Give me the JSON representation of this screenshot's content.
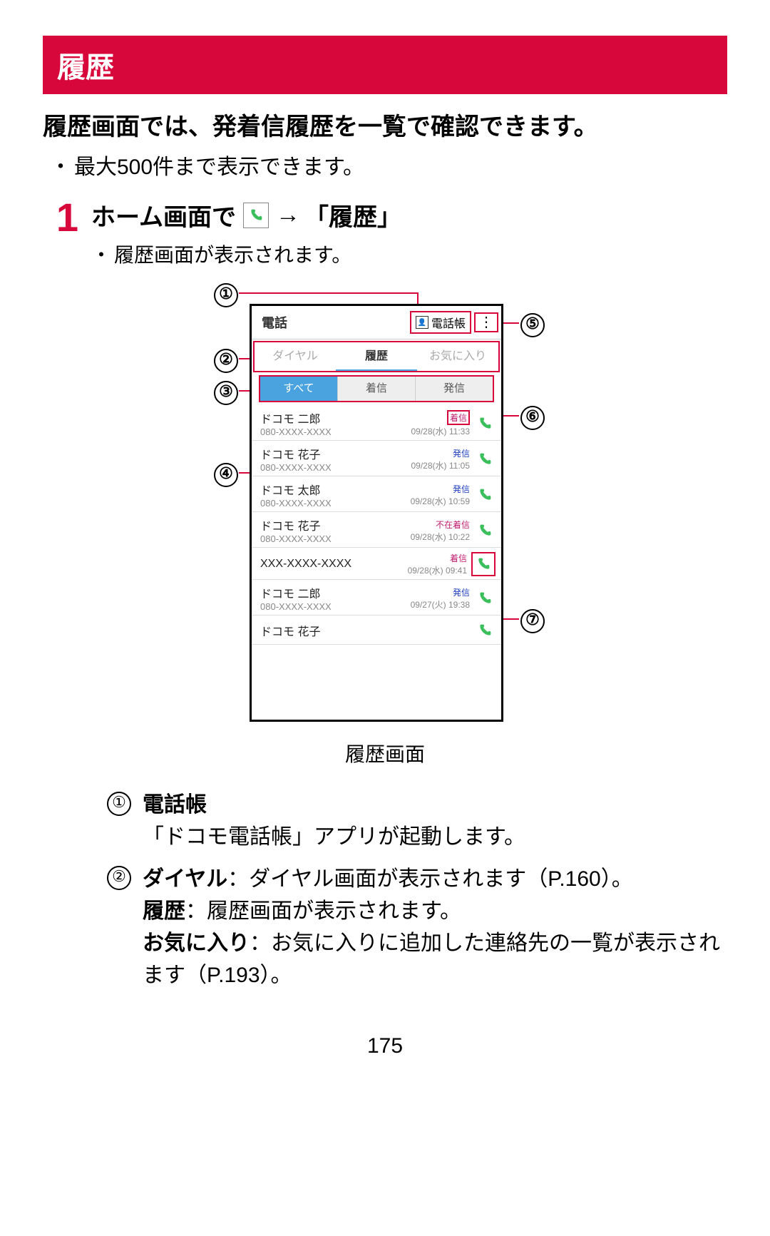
{
  "header": {
    "title": "履歴"
  },
  "lead": "履歴画面では、発着信履歴を一覧で確認できます。",
  "note": "最大500件まで表示できます。",
  "step": {
    "num": "1",
    "head_pre": "ホーム画面で",
    "head_arrow": "→",
    "head_post": "「履歴」",
    "sub": "履歴画面が表示されます。"
  },
  "callouts": {
    "1": "①",
    "2": "②",
    "3": "③",
    "4": "④",
    "5": "⑤",
    "6": "⑥",
    "7": "⑦"
  },
  "phone": {
    "header_title": "電話",
    "contacts_label": "電話帳",
    "tabs": {
      "dial": "ダイヤル",
      "history": "履歴",
      "fav": "お気に入り"
    },
    "filters": {
      "all": "すべて",
      "in": "着信",
      "out": "発信"
    },
    "badges": {
      "in": "着信",
      "out": "発信",
      "miss": "不在着信"
    },
    "items": [
      {
        "name": "ドコモ 二郎",
        "num": "080-XXXX-XXXX",
        "time": "09/28(水) 11:33",
        "type": "in",
        "badge_box": true
      },
      {
        "name": "ドコモ 花子",
        "num": "080-XXXX-XXXX",
        "time": "09/28(水) 11:05",
        "type": "out"
      },
      {
        "name": "ドコモ 太郎",
        "num": "080-XXXX-XXXX",
        "time": "09/28(水) 10:59",
        "type": "out"
      },
      {
        "name": "ドコモ 花子",
        "num": "080-XXXX-XXXX",
        "time": "09/28(水) 10:22",
        "type": "miss"
      },
      {
        "name": "XXX-XXXX-XXXX",
        "num": "",
        "time": "09/28(水) 09:41",
        "type": "in",
        "call_box": true
      },
      {
        "name": "ドコモ 二郎",
        "num": "080-XXXX-XXXX",
        "time": "09/27(火) 19:38",
        "type": "out"
      },
      {
        "name": "ドコモ 花子",
        "num": "",
        "time": "",
        "type": ""
      }
    ]
  },
  "caption": "履歴画面",
  "desc": {
    "1": {
      "title": "電話帳",
      "body": "「ドコモ電話帳」アプリが起動します。"
    },
    "2": {
      "l1": {
        "bold": "ダイヤル",
        "rest": "：ダイヤル画面が表示されます（P.160）。"
      },
      "l2": {
        "bold": "履歴",
        "rest": "：履歴画面が表示されます。"
      },
      "l3": {
        "bold": "お気に入り",
        "rest": "：お気に入りに追加した連絡先の一覧が表示されます（P.193）。"
      }
    }
  },
  "page_number": "175"
}
